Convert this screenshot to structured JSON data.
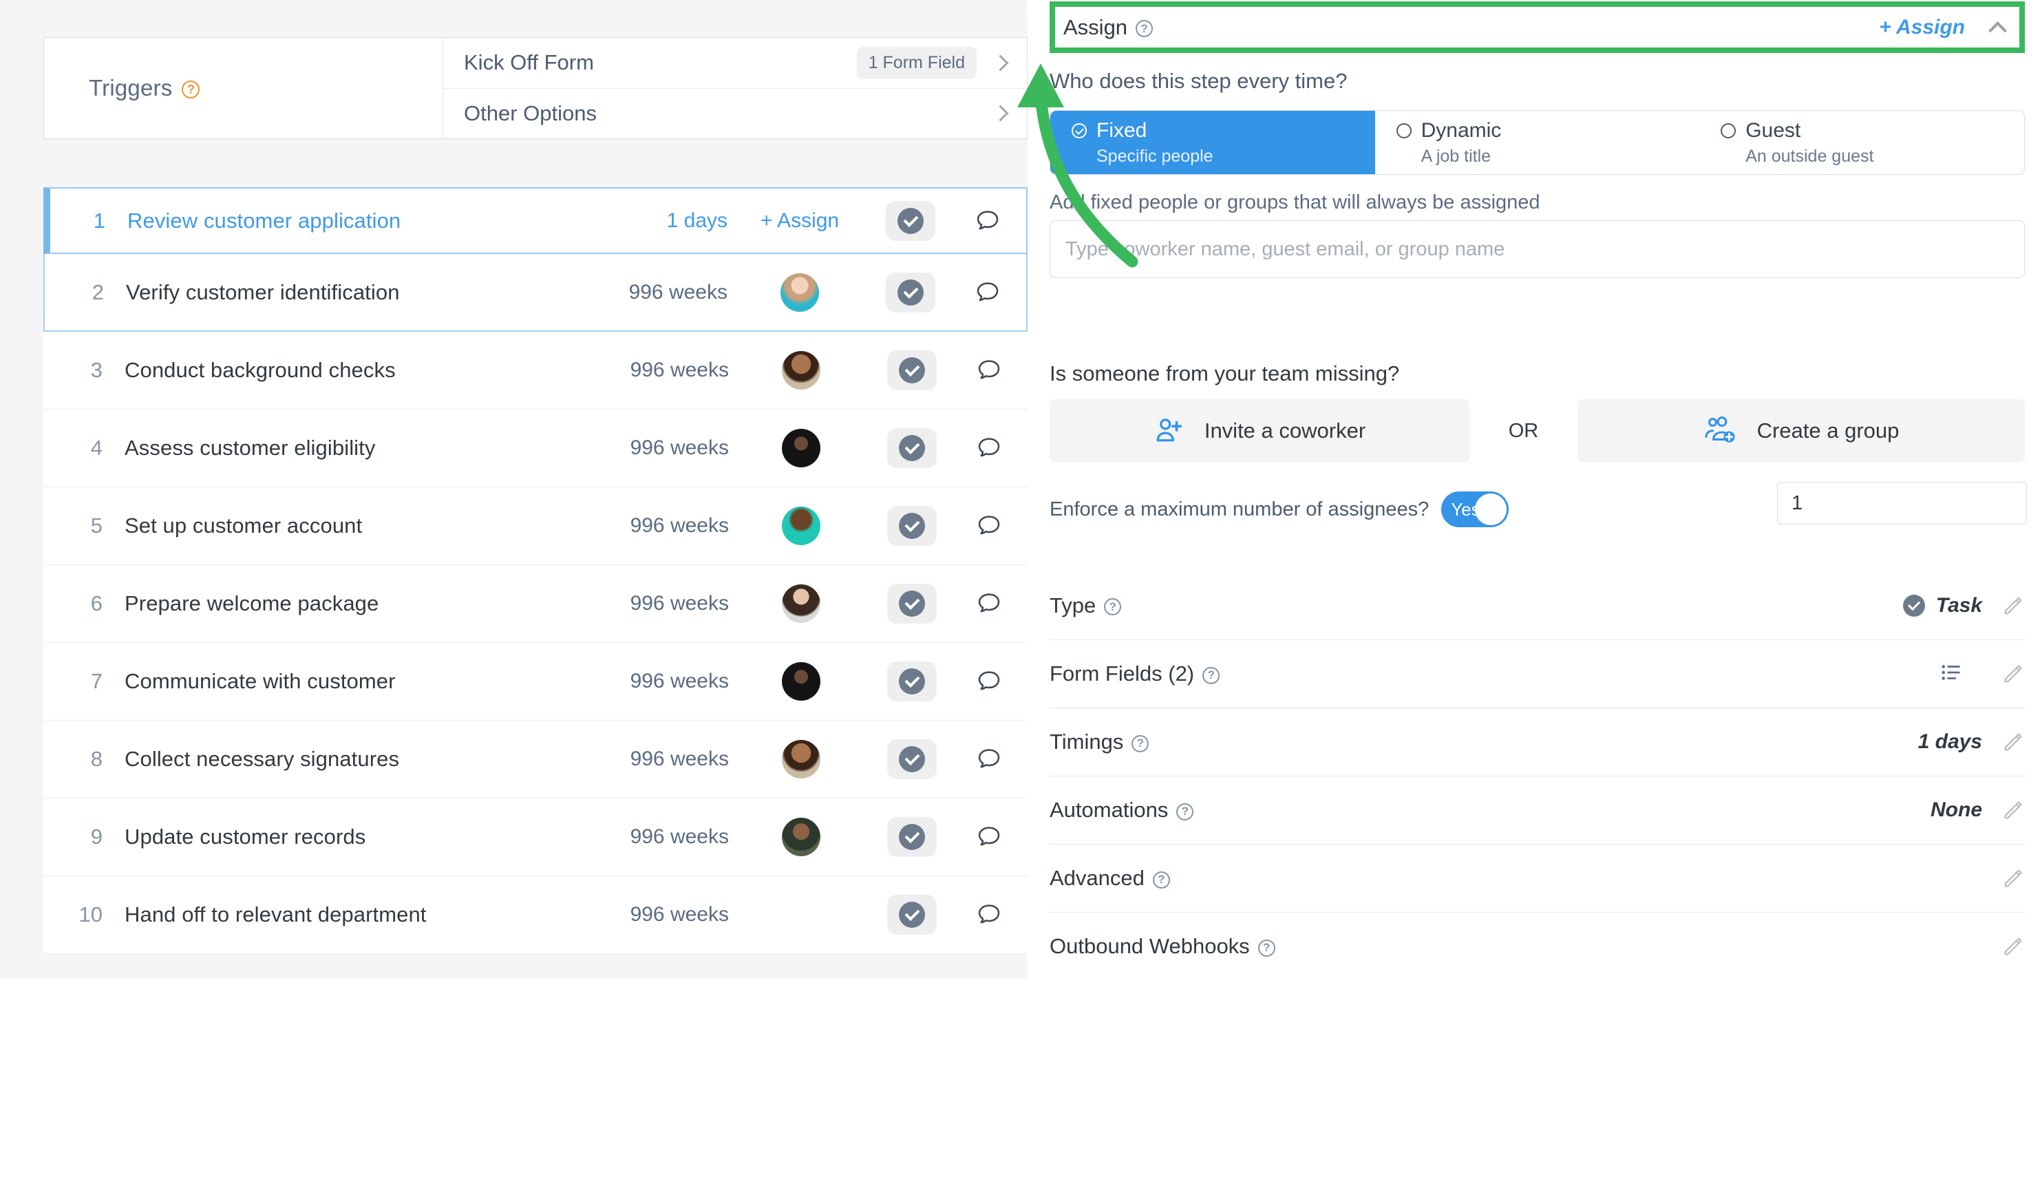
{
  "left": {
    "triggers": {
      "label": "Triggers",
      "help_icon": "question-circle-icon"
    },
    "kickoff": {
      "label": "Kick Off Form",
      "badge": "1 Form Field",
      "chevron": "chevron-right-icon"
    },
    "other_options": {
      "label": "Other Options",
      "chevron": "chevron-right-icon"
    },
    "steps": [
      {
        "num": "1",
        "title": "Review customer application",
        "due": "1 days",
        "assign_label": "+ Assign",
        "has_avatar": false,
        "selected": true
      },
      {
        "num": "2",
        "title": "Verify customer identification",
        "due": "996 weeks",
        "assign_label": "",
        "has_avatar": true,
        "selected": false
      },
      {
        "num": "3",
        "title": "Conduct background checks",
        "due": "996 weeks",
        "assign_label": "",
        "has_avatar": true,
        "selected": false
      },
      {
        "num": "4",
        "title": "Assess customer eligibility",
        "due": "996 weeks",
        "assign_label": "",
        "has_avatar": true,
        "selected": false
      },
      {
        "num": "5",
        "title": "Set up customer account",
        "due": "996 weeks",
        "assign_label": "",
        "has_avatar": true,
        "selected": false
      },
      {
        "num": "6",
        "title": "Prepare welcome package",
        "due": "996 weeks",
        "assign_label": "",
        "has_avatar": true,
        "selected": false
      },
      {
        "num": "7",
        "title": "Communicate with customer",
        "due": "996 weeks",
        "assign_label": "",
        "has_avatar": true,
        "selected": false
      },
      {
        "num": "8",
        "title": "Collect necessary signatures",
        "due": "996 weeks",
        "assign_label": "",
        "has_avatar": true,
        "selected": false
      },
      {
        "num": "9",
        "title": "Update customer records",
        "due": "996 weeks",
        "assign_label": "",
        "has_avatar": true,
        "selected": false
      },
      {
        "num": "10",
        "title": "Hand off to relevant department",
        "due": "996 weeks",
        "assign_label": "",
        "has_avatar": false,
        "selected": false
      }
    ],
    "row_icons": {
      "complete": "check-circle-icon",
      "comment": "comment-bubble-icon"
    }
  },
  "right": {
    "header": {
      "title": "Assign",
      "help_icon": "question-circle-icon",
      "add_label": "+ Assign",
      "collapse_icon": "chevron-up-icon",
      "highlight_color": "#3cb85c"
    },
    "question": "Who does this step every time?",
    "assign_modes": [
      {
        "name": "Fixed",
        "sub": "Specific people",
        "selected": true
      },
      {
        "name": "Dynamic",
        "sub": "A job title",
        "selected": false
      },
      {
        "name": "Guest",
        "sub": "An outside guest",
        "selected": false
      }
    ],
    "add_fixed_label": "Add fixed people or groups that will always be assigned",
    "assignee_input": {
      "value": "",
      "placeholder": "Type coworker name, guest email, or group name"
    },
    "missing_label": "Is someone from your team missing?",
    "invite_button": {
      "label": "Invite a coworker",
      "icon": "user-plus-icon"
    },
    "or_label": "OR",
    "group_button": {
      "label": "Create a group",
      "icon": "users-plus-icon"
    },
    "enforce": {
      "label": "Enforce a maximum number of assignees?",
      "toggle_text": "Yes",
      "toggle_on": true,
      "max_value": "1"
    },
    "settings": [
      {
        "label": "Type",
        "value": "Task",
        "has_type_check": true,
        "has_list_icon": false,
        "pencil": "pencil-icon"
      },
      {
        "label": "Form Fields (2)",
        "value": "",
        "has_type_check": false,
        "has_list_icon": true,
        "pencil": "pencil-icon"
      },
      {
        "label": "Timings",
        "value": "1 days",
        "has_type_check": false,
        "has_list_icon": false,
        "pencil": "pencil-icon"
      },
      {
        "label": "Automations",
        "value": "None",
        "has_type_check": false,
        "has_list_icon": false,
        "pencil": "pencil-icon"
      },
      {
        "label": "Advanced",
        "value": "",
        "has_type_check": false,
        "has_list_icon": false,
        "pencil": "pencil-icon"
      },
      {
        "label": "Outbound Webhooks",
        "value": "",
        "has_type_check": false,
        "has_list_icon": false,
        "pencil": "pencil-icon"
      }
    ]
  },
  "annotation": {
    "arrow_color": "#3cb85c",
    "arrow_name": "green-callout-arrow"
  }
}
